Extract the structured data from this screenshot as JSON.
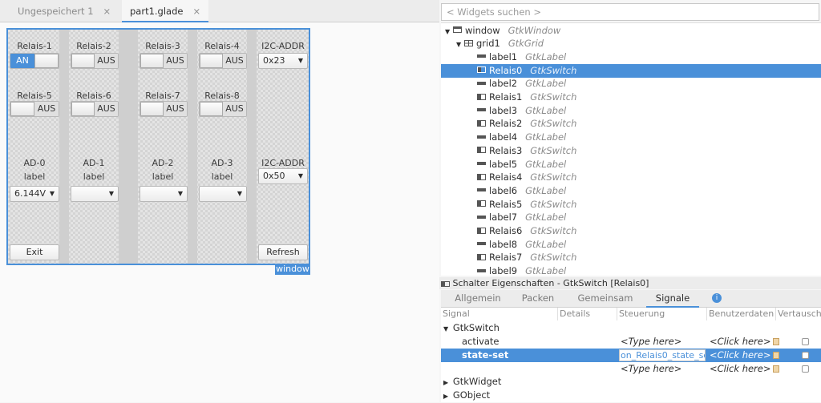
{
  "tabs": [
    {
      "label": "Ungespeichert 1",
      "close": "×"
    },
    {
      "label": "part1.glade",
      "close": "×"
    }
  ],
  "design": {
    "window_label": "window",
    "row1": {
      "labels": [
        "Relais-1",
        "Relais-2",
        "Relais-3",
        "Relais-4",
        "I2C-ADDR"
      ],
      "switch_on": "AN",
      "switch_off": "AUS",
      "combo": "0x23"
    },
    "row2": {
      "labels": [
        "Relais-5",
        "Relais-6",
        "Relais-7",
        "Relais-8"
      ],
      "switch_off": "AUS"
    },
    "row3": {
      "ad_labels": [
        "AD-0",
        "AD-1",
        "AD-2",
        "AD-3",
        "I2C-ADDR"
      ],
      "value_label": "label",
      "combo_first": "6.144V",
      "combo_addr": "0x50"
    },
    "exit_label": "Exit",
    "refresh_label": "Refresh",
    "arrow": "▼"
  },
  "widget_search": {
    "placeholder": "< Widgets suchen >"
  },
  "tree": [
    {
      "name": "window",
      "type": "GtkWindow",
      "icon": "window-icon",
      "level": 0,
      "expander": "▼",
      "selected": false
    },
    {
      "name": "grid1",
      "type": "GtkGrid",
      "icon": "grid-icon",
      "level": 1,
      "expander": "▼",
      "selected": false
    },
    {
      "name": "label1",
      "type": "GtkLabel",
      "icon": "label-icon",
      "level": 2,
      "selected": false
    },
    {
      "name": "Relais0",
      "type": "GtkSwitch",
      "icon": "switch-icon",
      "level": 2,
      "selected": true
    },
    {
      "name": "label2",
      "type": "GtkLabel",
      "icon": "label-icon",
      "level": 2,
      "selected": false
    },
    {
      "name": "Relais1",
      "type": "GtkSwitch",
      "icon": "switch-icon",
      "level": 2,
      "selected": false
    },
    {
      "name": "label3",
      "type": "GtkLabel",
      "icon": "label-icon",
      "level": 2,
      "selected": false
    },
    {
      "name": "Relais2",
      "type": "GtkSwitch",
      "icon": "switch-icon",
      "level": 2,
      "selected": false
    },
    {
      "name": "label4",
      "type": "GtkLabel",
      "icon": "label-icon",
      "level": 2,
      "selected": false
    },
    {
      "name": "Relais3",
      "type": "GtkSwitch",
      "icon": "switch-icon",
      "level": 2,
      "selected": false
    },
    {
      "name": "label5",
      "type": "GtkLabel",
      "icon": "label-icon",
      "level": 2,
      "selected": false
    },
    {
      "name": "Relais4",
      "type": "GtkSwitch",
      "icon": "switch-icon",
      "level": 2,
      "selected": false
    },
    {
      "name": "label6",
      "type": "GtkLabel",
      "icon": "label-icon",
      "level": 2,
      "selected": false
    },
    {
      "name": "Relais5",
      "type": "GtkSwitch",
      "icon": "switch-icon",
      "level": 2,
      "selected": false
    },
    {
      "name": "label7",
      "type": "GtkLabel",
      "icon": "label-icon",
      "level": 2,
      "selected": false
    },
    {
      "name": "Relais6",
      "type": "GtkSwitch",
      "icon": "switch-icon",
      "level": 2,
      "selected": false
    },
    {
      "name": "label8",
      "type": "GtkLabel",
      "icon": "label-icon",
      "level": 2,
      "selected": false
    },
    {
      "name": "Relais7",
      "type": "GtkSwitch",
      "icon": "switch-icon",
      "level": 2,
      "selected": false
    },
    {
      "name": "label9",
      "type": "GtkLabel",
      "icon": "label-icon",
      "level": 2,
      "selected": false
    }
  ],
  "properties": {
    "title": "Schalter Eigenschaften - GtkSwitch [Relais0]",
    "tabs": [
      "Allgemein",
      "Packen",
      "Gemeinsam",
      "Signale"
    ],
    "active_tab": "Signale",
    "info_icon": "i",
    "columns": [
      "Signal",
      "Details",
      "Steuerung",
      "Benutzerdaten",
      "Vertausch"
    ],
    "group_gtkswitch": "GtkSwitch",
    "signals": [
      {
        "name": "activate",
        "handler": "<Type here>",
        "userdata": "<Click here>",
        "selected": false
      },
      {
        "name": "state-set",
        "handler": "on_Relais0_state_set",
        "userdata": "<Click here>",
        "selected": true
      },
      {
        "name": "",
        "handler": "<Type here>",
        "userdata": "<Click here>",
        "selected": false
      }
    ],
    "group_gtkwidget": "GtkWidget",
    "group_gobject": "GObject",
    "expand_open": "▼",
    "expand_closed": "▶"
  },
  "colors": {
    "accent": "#4a90d9"
  }
}
